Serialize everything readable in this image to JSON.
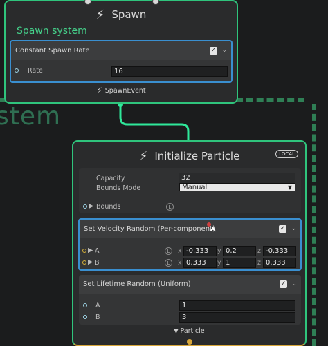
{
  "background": {
    "system_label": "stem"
  },
  "spawn_node": {
    "title": "Spawn",
    "system_name": "Spawn system",
    "block": {
      "title": "Constant Spawn Rate",
      "rate_label": "Rate",
      "rate_value": "16"
    },
    "output_label": "SpawnEvent"
  },
  "init_node": {
    "title": "Initialize Particle",
    "badge": "LOCAL",
    "capacity_label": "Capacity",
    "capacity_value": "32",
    "bounds_mode_label": "Bounds Mode",
    "bounds_mode_value": "Manual",
    "bounds_label": "Bounds",
    "velocity_block": {
      "title": "Set Velocity Random (Per-component)",
      "a_label": "A",
      "b_label": "B",
      "a": {
        "x": "-0.333",
        "y": "0.2",
        "z": "-0.333"
      },
      "b": {
        "x": "0.333",
        "y": "1",
        "z": "0.333"
      },
      "axis_x": "x",
      "axis_y": "y",
      "axis_z": "z"
    },
    "lifetime_block": {
      "title": "Set Lifetime Random (Uniform)",
      "a_label": "A",
      "a_value": "1",
      "b_label": "B",
      "b_value": "3"
    },
    "output_label": "Particle"
  },
  "local_icon": "L",
  "colors": {
    "spawn_border": "#2fc47c",
    "flow_wire": "#2fe89a",
    "selected_block": "#3a8fd0",
    "system_text": "#45d08a",
    "particle_port": "#d8a73a"
  },
  "icons": [
    "bolt-icon",
    "checkbox-icon",
    "chevron-down-icon",
    "port-icon",
    "local-space-icon",
    "mouse-cursor-icon"
  ]
}
